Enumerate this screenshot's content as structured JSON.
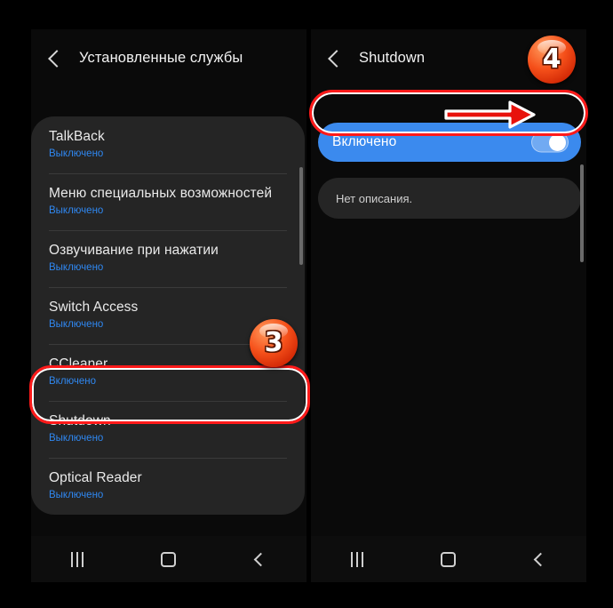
{
  "left_panel": {
    "title": "Установленные службы",
    "back_icon": "back-chevron-icon",
    "services": [
      {
        "name": "TalkBack",
        "status": "Выключено"
      },
      {
        "name": "Меню специальных возможностей",
        "status": "Выключено"
      },
      {
        "name": "Озвучивание при нажатии",
        "status": "Выключено"
      },
      {
        "name": "Switch Access",
        "status": "Выключено"
      },
      {
        "name": "CCleaner",
        "status": "Включено"
      },
      {
        "name": "Shutdown",
        "status": "Выключено"
      },
      {
        "name": "Optical Reader",
        "status": "Выключено"
      }
    ]
  },
  "right_panel": {
    "title": "Shutdown",
    "back_icon": "back-chevron-icon",
    "toggle": {
      "label": "Включено",
      "state": "on"
    },
    "description": "Нет описания."
  },
  "navbar": {
    "recents_icon": "recents-icon",
    "home_icon": "home-icon",
    "back_icon": "back-icon"
  },
  "annotations": {
    "badge_3": "3",
    "badge_4": "4",
    "arrow_icon": "right-arrow-icon"
  },
  "colors": {
    "accent_blue": "#2f87f0",
    "toggle_blue": "#3b8aee",
    "highlight_red": "#ff1a1a",
    "badge_orange": "#f5501a",
    "card_bg": "#252525",
    "panel_bg": "#0a0a0a"
  }
}
